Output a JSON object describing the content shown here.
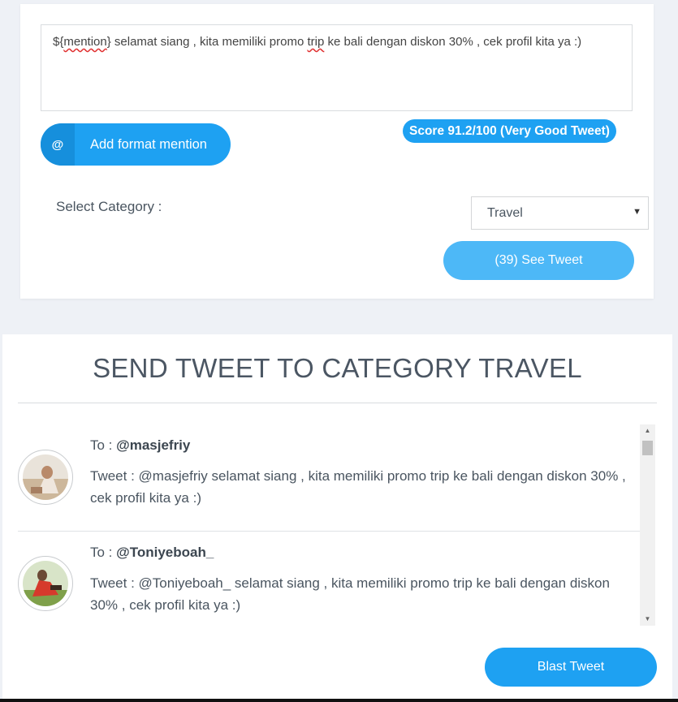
{
  "compose": {
    "mention_token": "mention",
    "text_before": "${",
    "text_mid1": "} selamat siang , kita memiliki promo ",
    "text_trip": "trip",
    "text_after": " ke bali dengan diskon 30% , cek profil kita ya :)"
  },
  "mention_button": {
    "icon": "@",
    "label": "Add format mention"
  },
  "score": {
    "label": "Score 91.2/100 (Very Good Tweet)",
    "color": "#1ea1f2"
  },
  "category": {
    "label": "Select Category :",
    "selected": "Travel",
    "caret": "▼"
  },
  "see_tweet": {
    "label": "(39) See Tweet"
  },
  "send_section": {
    "title": "SEND TWEET TO CATEGORY TRAVEL",
    "items": [
      {
        "to_prefix": "To : ",
        "handle": "@masjefriy",
        "tweet": "Tweet : @masjefriy selamat siang , kita memiliki promo trip ke bali dengan diskon 30% , cek profil kita ya :)"
      },
      {
        "to_prefix": "To : ",
        "handle": "@Toniyeboah_",
        "tweet": "Tweet : @Toniyeboah_ selamat siang , kita memiliki promo trip ke bali dengan diskon 30% , cek profil kita ya :)"
      }
    ],
    "scroll": {
      "up": "▲",
      "down": "▼"
    }
  },
  "blast_button": {
    "label": "Blast Tweet"
  },
  "colors": {
    "primary": "#1ea1f2",
    "secondary": "#4db8f7",
    "background": "#eef1f6"
  }
}
